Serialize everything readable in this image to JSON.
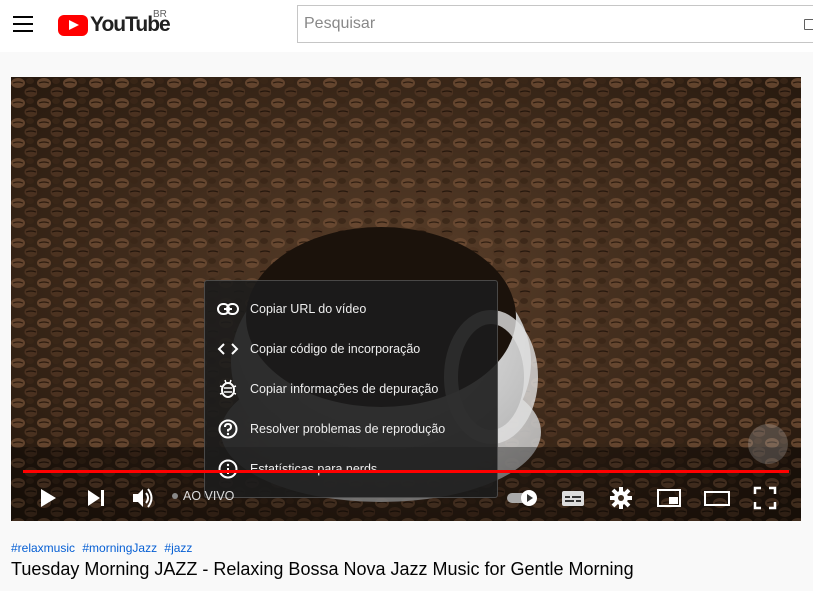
{
  "masthead": {
    "logo_text": "YouTube",
    "country_code": "BR",
    "search_placeholder": "Pesquisar"
  },
  "player": {
    "context_menu": [
      {
        "label": "Copiar URL do vídeo",
        "icon": "link-icon"
      },
      {
        "label": "Copiar código de incorporação",
        "icon": "code-icon"
      },
      {
        "label": "Copiar informações de depuração",
        "icon": "bug-icon"
      },
      {
        "label": "Resolver problemas de reprodução",
        "icon": "help-circle-icon"
      },
      {
        "label": "Estatísticas para nerds",
        "icon": "info-icon"
      }
    ],
    "live_label": "AO VIVO",
    "colors": {
      "progress": "#ff0000",
      "menu_bg": "#1c1c1c"
    }
  },
  "video": {
    "hashtags": [
      "#relaxmusic",
      "#morningJazz",
      "#jazz"
    ],
    "title": "Tuesday Morning JAZZ - Relaxing Bossa Nova Jazz Music for Gentle Morning"
  }
}
